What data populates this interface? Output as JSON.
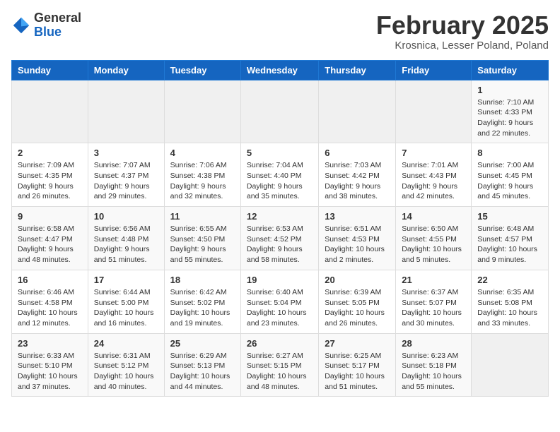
{
  "header": {
    "logo_general": "General",
    "logo_blue": "Blue",
    "month_title": "February 2025",
    "location": "Krosnica, Lesser Poland, Poland"
  },
  "calendar": {
    "days_of_week": [
      "Sunday",
      "Monday",
      "Tuesday",
      "Wednesday",
      "Thursday",
      "Friday",
      "Saturday"
    ],
    "weeks": [
      [
        {
          "day": "",
          "info": ""
        },
        {
          "day": "",
          "info": ""
        },
        {
          "day": "",
          "info": ""
        },
        {
          "day": "",
          "info": ""
        },
        {
          "day": "",
          "info": ""
        },
        {
          "day": "",
          "info": ""
        },
        {
          "day": "1",
          "info": "Sunrise: 7:10 AM\nSunset: 4:33 PM\nDaylight: 9 hours and 22 minutes."
        }
      ],
      [
        {
          "day": "2",
          "info": "Sunrise: 7:09 AM\nSunset: 4:35 PM\nDaylight: 9 hours and 26 minutes."
        },
        {
          "day": "3",
          "info": "Sunrise: 7:07 AM\nSunset: 4:37 PM\nDaylight: 9 hours and 29 minutes."
        },
        {
          "day": "4",
          "info": "Sunrise: 7:06 AM\nSunset: 4:38 PM\nDaylight: 9 hours and 32 minutes."
        },
        {
          "day": "5",
          "info": "Sunrise: 7:04 AM\nSunset: 4:40 PM\nDaylight: 9 hours and 35 minutes."
        },
        {
          "day": "6",
          "info": "Sunrise: 7:03 AM\nSunset: 4:42 PM\nDaylight: 9 hours and 38 minutes."
        },
        {
          "day": "7",
          "info": "Sunrise: 7:01 AM\nSunset: 4:43 PM\nDaylight: 9 hours and 42 minutes."
        },
        {
          "day": "8",
          "info": "Sunrise: 7:00 AM\nSunset: 4:45 PM\nDaylight: 9 hours and 45 minutes."
        }
      ],
      [
        {
          "day": "9",
          "info": "Sunrise: 6:58 AM\nSunset: 4:47 PM\nDaylight: 9 hours and 48 minutes."
        },
        {
          "day": "10",
          "info": "Sunrise: 6:56 AM\nSunset: 4:48 PM\nDaylight: 9 hours and 51 minutes."
        },
        {
          "day": "11",
          "info": "Sunrise: 6:55 AM\nSunset: 4:50 PM\nDaylight: 9 hours and 55 minutes."
        },
        {
          "day": "12",
          "info": "Sunrise: 6:53 AM\nSunset: 4:52 PM\nDaylight: 9 hours and 58 minutes."
        },
        {
          "day": "13",
          "info": "Sunrise: 6:51 AM\nSunset: 4:53 PM\nDaylight: 10 hours and 2 minutes."
        },
        {
          "day": "14",
          "info": "Sunrise: 6:50 AM\nSunset: 4:55 PM\nDaylight: 10 hours and 5 minutes."
        },
        {
          "day": "15",
          "info": "Sunrise: 6:48 AM\nSunset: 4:57 PM\nDaylight: 10 hours and 9 minutes."
        }
      ],
      [
        {
          "day": "16",
          "info": "Sunrise: 6:46 AM\nSunset: 4:58 PM\nDaylight: 10 hours and 12 minutes."
        },
        {
          "day": "17",
          "info": "Sunrise: 6:44 AM\nSunset: 5:00 PM\nDaylight: 10 hours and 16 minutes."
        },
        {
          "day": "18",
          "info": "Sunrise: 6:42 AM\nSunset: 5:02 PM\nDaylight: 10 hours and 19 minutes."
        },
        {
          "day": "19",
          "info": "Sunrise: 6:40 AM\nSunset: 5:04 PM\nDaylight: 10 hours and 23 minutes."
        },
        {
          "day": "20",
          "info": "Sunrise: 6:39 AM\nSunset: 5:05 PM\nDaylight: 10 hours and 26 minutes."
        },
        {
          "day": "21",
          "info": "Sunrise: 6:37 AM\nSunset: 5:07 PM\nDaylight: 10 hours and 30 minutes."
        },
        {
          "day": "22",
          "info": "Sunrise: 6:35 AM\nSunset: 5:08 PM\nDaylight: 10 hours and 33 minutes."
        }
      ],
      [
        {
          "day": "23",
          "info": "Sunrise: 6:33 AM\nSunset: 5:10 PM\nDaylight: 10 hours and 37 minutes."
        },
        {
          "day": "24",
          "info": "Sunrise: 6:31 AM\nSunset: 5:12 PM\nDaylight: 10 hours and 40 minutes."
        },
        {
          "day": "25",
          "info": "Sunrise: 6:29 AM\nSunset: 5:13 PM\nDaylight: 10 hours and 44 minutes."
        },
        {
          "day": "26",
          "info": "Sunrise: 6:27 AM\nSunset: 5:15 PM\nDaylight: 10 hours and 48 minutes."
        },
        {
          "day": "27",
          "info": "Sunrise: 6:25 AM\nSunset: 5:17 PM\nDaylight: 10 hours and 51 minutes."
        },
        {
          "day": "28",
          "info": "Sunrise: 6:23 AM\nSunset: 5:18 PM\nDaylight: 10 hours and 55 minutes."
        },
        {
          "day": "",
          "info": ""
        }
      ]
    ]
  }
}
